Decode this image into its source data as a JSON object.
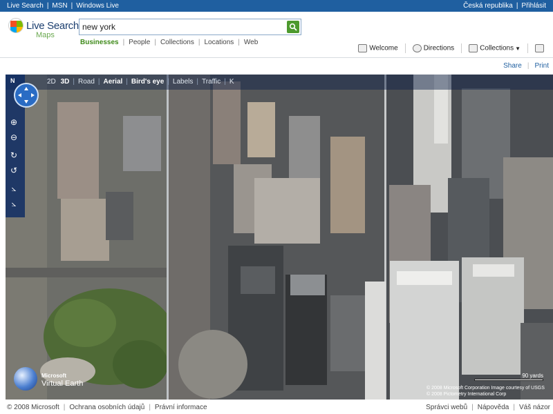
{
  "topbar": {
    "links": [
      "Live Search",
      "MSN",
      "Windows Live"
    ],
    "region": "Česká republika",
    "signin": "Přihlásit"
  },
  "brand": {
    "title": "Live Search",
    "subtitle": "Maps",
    "logo_icon": "windows-flag-icon"
  },
  "search": {
    "value": "new york",
    "button_icon": "search-icon"
  },
  "scopes": {
    "items": [
      "Businesses",
      "People",
      "Collections",
      "Locations",
      "Web"
    ],
    "active": "Businesses"
  },
  "header_actions": {
    "welcome": "Welcome",
    "directions": "Directions",
    "collections": "Collections"
  },
  "share": {
    "share": "Share",
    "print": "Print"
  },
  "map": {
    "compass_label": "N",
    "modes": {
      "d2": "2D",
      "d3": "3D",
      "road": "Road",
      "aerial": "Aerial",
      "birdseye": "Bird's eye",
      "labels": "Labels",
      "traffic": "Traffic",
      "collapse": "K"
    },
    "active_mode": "Aerial",
    "scale_label": "90 yards",
    "copyright_1": "© 2008 Microsoft Corporation  Image courtesy of USGS",
    "copyright_2": "© 2008 Pictometry International Corp",
    "ve_microsoft": "Microsoft",
    "ve_name": "Virtual Earth",
    "accent": "#1f5fa0"
  },
  "footer": {
    "copyright": "© 2008 Microsoft",
    "privacy": "Ochrana osobních údajů",
    "legal": "Právní informace",
    "webmaster": "Správci webů",
    "help": "Nápověda",
    "feedback": "Váš názor"
  }
}
